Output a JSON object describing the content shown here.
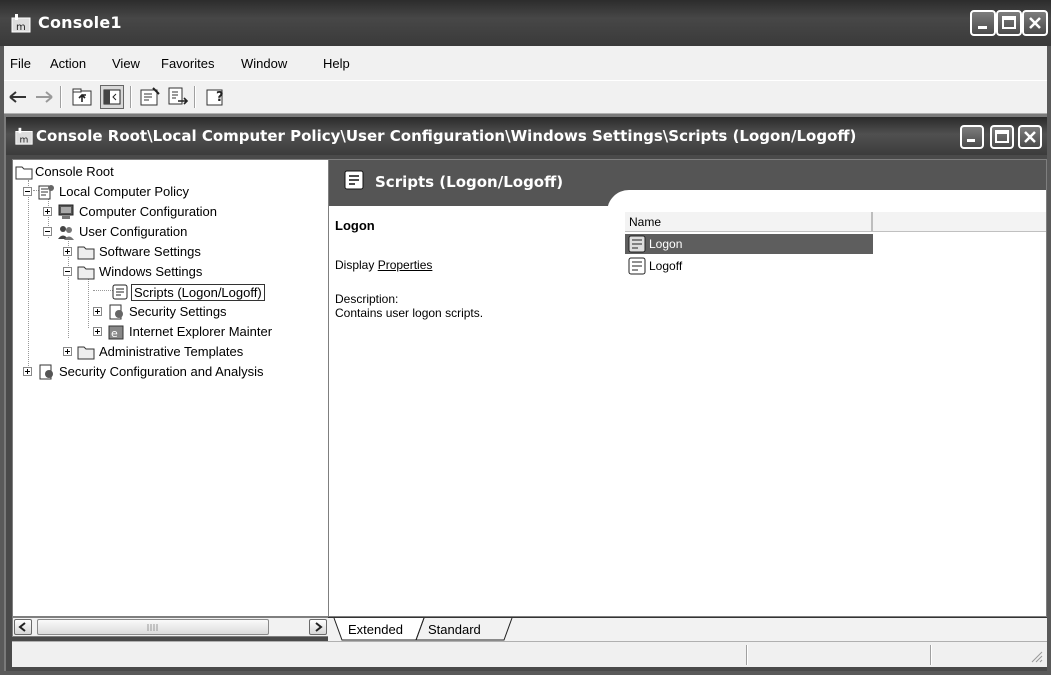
{
  "app": {
    "title": "Console1",
    "window_buttons": [
      "minimize",
      "maximize",
      "close"
    ]
  },
  "menu": [
    "File",
    "Action",
    "View",
    "Favorites",
    "Window",
    "Help"
  ],
  "toolbar": {
    "buttons": [
      "back-icon",
      "forward-icon",
      "up-one-level-icon",
      "show-hide-tree-icon",
      "properties-icon",
      "export-list-icon",
      "help-icon"
    ]
  },
  "child": {
    "title": "Console Root\\Local Computer Policy\\User Configuration\\Windows Settings\\Scripts (Logon/Logoff)"
  },
  "tree": {
    "items": [
      {
        "label": "Console Root",
        "icon": "folder-icon"
      },
      {
        "label": "Local Computer Policy",
        "icon": "policy-icon",
        "expanded": true
      },
      {
        "label": "Computer Configuration",
        "icon": "computer-icon",
        "expanded": false
      },
      {
        "label": "User Configuration",
        "icon": "users-icon",
        "expanded": true
      },
      {
        "label": "Software Settings",
        "icon": "folder-icon",
        "expanded": false
      },
      {
        "label": "Windows Settings",
        "icon": "folder-icon",
        "expanded": true
      },
      {
        "label": "Scripts (Logon/Logoff)",
        "icon": "script-icon",
        "selected": true
      },
      {
        "label": "Security Settings",
        "icon": "security-icon",
        "expanded": false
      },
      {
        "label": "Internet Explorer Mainter",
        "icon": "ie-icon",
        "expanded": false
      },
      {
        "label": "Administrative Templates",
        "icon": "folder-icon",
        "expanded": false
      },
      {
        "label": "Security Configuration and Analysis",
        "icon": "security-analysis-icon",
        "expanded": false
      }
    ]
  },
  "details": {
    "header": "Scripts (Logon/Logoff)",
    "selected_title": "Logon",
    "display_prefix": "Display ",
    "display_link": "Properties",
    "description_label": "Description:",
    "description_text": "Contains user logon scripts."
  },
  "list": {
    "column": "Name",
    "rows": [
      {
        "name": "Logon",
        "selected": true,
        "icon": "script-icon"
      },
      {
        "name": "Logoff",
        "selected": false,
        "icon": "script-icon"
      }
    ]
  },
  "tabs": [
    "Extended",
    "Standard"
  ],
  "active_tab": "Extended",
  "colors": {
    "titlebar": "#3c3c3c",
    "selection": "#5e5e5e",
    "panel_bg": "#ffffff"
  }
}
